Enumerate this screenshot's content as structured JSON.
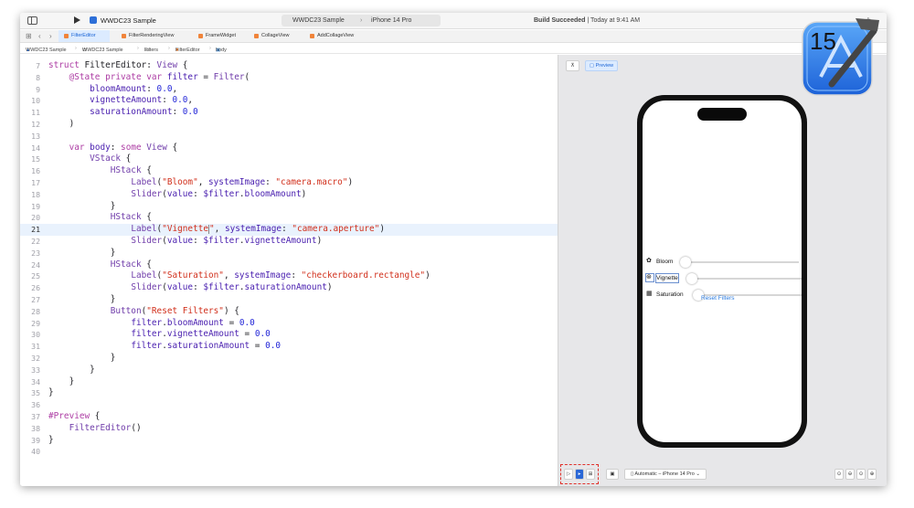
{
  "titlebar": {
    "project": "WWDC23 Sample",
    "scheme_target": "WWDC23 Sample",
    "scheme_device": "iPhone 14 Pro",
    "build_status_bold": "Build Succeeded",
    "build_status_rest": " | Today at 9:41 AM"
  },
  "tabs": [
    {
      "label": "FilterEditor",
      "active": true
    },
    {
      "label": "FilterRenderingView"
    },
    {
      "label": "FrameWidget"
    },
    {
      "label": "CollageView"
    },
    {
      "label": "AddCollageView"
    }
  ],
  "breadcrumb": [
    "WWDC23 Sample",
    "WWDC23 Sample",
    "Filters",
    "FilterEditor",
    "body"
  ],
  "editor": {
    "current_line": 21,
    "lines": [
      {
        "n": "7",
        "tokens": [
          [
            "kw",
            "struct"
          ],
          [
            "pl",
            " FilterEditor: "
          ],
          [
            "ty",
            "View"
          ],
          [
            "pl",
            " {"
          ]
        ]
      },
      {
        "n": "8",
        "tokens": [
          [
            "pl",
            "    "
          ],
          [
            "kw",
            "@State private var"
          ],
          [
            "pl",
            " "
          ],
          [
            "pr",
            "filter"
          ],
          [
            "pl",
            " = "
          ],
          [
            "ty",
            "Filter"
          ],
          [
            "pl",
            "("
          ]
        ]
      },
      {
        "n": "9",
        "tokens": [
          [
            "pl",
            "        "
          ],
          [
            "pr",
            "bloomAmount"
          ],
          [
            "pl",
            ": "
          ],
          [
            "num",
            "0.0"
          ],
          [
            "pl",
            ","
          ]
        ]
      },
      {
        "n": "10",
        "tokens": [
          [
            "pl",
            "        "
          ],
          [
            "pr",
            "vignetteAmount"
          ],
          [
            "pl",
            ": "
          ],
          [
            "num",
            "0.0"
          ],
          [
            "pl",
            ","
          ]
        ]
      },
      {
        "n": "11",
        "tokens": [
          [
            "pl",
            "        "
          ],
          [
            "pr",
            "saturationAmount"
          ],
          [
            "pl",
            ": "
          ],
          [
            "num",
            "0.0"
          ]
        ]
      },
      {
        "n": "12",
        "tokens": [
          [
            "pl",
            "    )"
          ]
        ]
      },
      {
        "n": "13",
        "tokens": []
      },
      {
        "n": "14",
        "tokens": [
          [
            "pl",
            "    "
          ],
          [
            "kw",
            "var"
          ],
          [
            "pl",
            " "
          ],
          [
            "pr",
            "body"
          ],
          [
            "pl",
            ": "
          ],
          [
            "kw",
            "some"
          ],
          [
            "pl",
            " "
          ],
          [
            "ty",
            "View"
          ],
          [
            "pl",
            " {"
          ]
        ]
      },
      {
        "n": "15",
        "tokens": [
          [
            "pl",
            "        "
          ],
          [
            "ty",
            "VStack"
          ],
          [
            "pl",
            " {"
          ]
        ]
      },
      {
        "n": "16",
        "tokens": [
          [
            "pl",
            "            "
          ],
          [
            "ty",
            "HStack"
          ],
          [
            "pl",
            " {"
          ]
        ]
      },
      {
        "n": "17",
        "tokens": [
          [
            "pl",
            "                "
          ],
          [
            "ty",
            "Label"
          ],
          [
            "pl",
            "("
          ],
          [
            "str",
            "\"Bloom\""
          ],
          [
            "pl",
            ", "
          ],
          [
            "pr",
            "systemImage"
          ],
          [
            "pl",
            ": "
          ],
          [
            "str",
            "\"camera.macro\""
          ],
          [
            "pl",
            ")"
          ]
        ]
      },
      {
        "n": "18",
        "tokens": [
          [
            "pl",
            "                "
          ],
          [
            "ty",
            "Slider"
          ],
          [
            "pl",
            "("
          ],
          [
            "pr",
            "value"
          ],
          [
            "pl",
            ": "
          ],
          [
            "pr",
            "$filter"
          ],
          [
            "pl",
            "."
          ],
          [
            "pr",
            "bloomAmount"
          ],
          [
            "pl",
            ")"
          ]
        ]
      },
      {
        "n": "19",
        "tokens": [
          [
            "pl",
            "            }"
          ]
        ]
      },
      {
        "n": "20",
        "tokens": [
          [
            "pl",
            "            "
          ],
          [
            "ty",
            "HStack"
          ],
          [
            "pl",
            " {"
          ]
        ]
      },
      {
        "n": "21",
        "tokens": [
          [
            "pl",
            "                "
          ],
          [
            "ty",
            "Label"
          ],
          [
            "pl",
            "("
          ],
          [
            "str",
            "\"Vignette"
          ],
          [
            "cursor",
            ""
          ],
          [
            "str",
            "\""
          ],
          [
            "pl",
            ", "
          ],
          [
            "pr",
            "systemImage"
          ],
          [
            "pl",
            ": "
          ],
          [
            "str",
            "\"camera.aperture\""
          ],
          [
            "pl",
            ")"
          ]
        ]
      },
      {
        "n": "22",
        "tokens": [
          [
            "pl",
            "                "
          ],
          [
            "ty",
            "Slider"
          ],
          [
            "pl",
            "("
          ],
          [
            "pr",
            "value"
          ],
          [
            "pl",
            ": "
          ],
          [
            "pr",
            "$filter"
          ],
          [
            "pl",
            "."
          ],
          [
            "pr",
            "vignetteAmount"
          ],
          [
            "pl",
            ")"
          ]
        ]
      },
      {
        "n": "23",
        "tokens": [
          [
            "pl",
            "            }"
          ]
        ]
      },
      {
        "n": "24",
        "tokens": [
          [
            "pl",
            "            "
          ],
          [
            "ty",
            "HStack"
          ],
          [
            "pl",
            " {"
          ]
        ]
      },
      {
        "n": "25",
        "tokens": [
          [
            "pl",
            "                "
          ],
          [
            "ty",
            "Label"
          ],
          [
            "pl",
            "("
          ],
          [
            "str",
            "\"Saturation\""
          ],
          [
            "pl",
            ", "
          ],
          [
            "pr",
            "systemImage"
          ],
          [
            "pl",
            ": "
          ],
          [
            "str",
            "\"checkerboard.rectangle\""
          ],
          [
            "pl",
            ")"
          ]
        ]
      },
      {
        "n": "26",
        "tokens": [
          [
            "pl",
            "                "
          ],
          [
            "ty",
            "Slider"
          ],
          [
            "pl",
            "("
          ],
          [
            "pr",
            "value"
          ],
          [
            "pl",
            ": "
          ],
          [
            "pr",
            "$filter"
          ],
          [
            "pl",
            "."
          ],
          [
            "pr",
            "saturationAmount"
          ],
          [
            "pl",
            ")"
          ]
        ]
      },
      {
        "n": "27",
        "tokens": [
          [
            "pl",
            "            }"
          ]
        ]
      },
      {
        "n": "28",
        "tokens": [
          [
            "pl",
            "            "
          ],
          [
            "ty",
            "Button"
          ],
          [
            "pl",
            "("
          ],
          [
            "str",
            "\"Reset Filters\""
          ],
          [
            "pl",
            ") {"
          ]
        ]
      },
      {
        "n": "29",
        "tokens": [
          [
            "pl",
            "                "
          ],
          [
            "pr",
            "filter"
          ],
          [
            "pl",
            "."
          ],
          [
            "pr",
            "bloomAmount"
          ],
          [
            "pl",
            " = "
          ],
          [
            "num",
            "0.0"
          ]
        ]
      },
      {
        "n": "30",
        "tokens": [
          [
            "pl",
            "                "
          ],
          [
            "pr",
            "filter"
          ],
          [
            "pl",
            "."
          ],
          [
            "pr",
            "vignetteAmount"
          ],
          [
            "pl",
            " = "
          ],
          [
            "num",
            "0.0"
          ]
        ]
      },
      {
        "n": "31",
        "tokens": [
          [
            "pl",
            "                "
          ],
          [
            "pr",
            "filter"
          ],
          [
            "pl",
            "."
          ],
          [
            "pr",
            "saturationAmount"
          ],
          [
            "pl",
            " = "
          ],
          [
            "num",
            "0.0"
          ]
        ]
      },
      {
        "n": "32",
        "tokens": [
          [
            "pl",
            "            }"
          ]
        ]
      },
      {
        "n": "33",
        "tokens": [
          [
            "pl",
            "        }"
          ]
        ]
      },
      {
        "n": "34",
        "tokens": [
          [
            "pl",
            "    }"
          ]
        ]
      },
      {
        "n": "35",
        "tokens": [
          [
            "pl",
            "}"
          ]
        ]
      },
      {
        "n": "36",
        "tokens": []
      },
      {
        "n": "37",
        "tokens": [
          [
            "kw",
            "#Preview"
          ],
          [
            "pl",
            " {"
          ]
        ]
      },
      {
        "n": "38",
        "tokens": [
          [
            "pl",
            "    "
          ],
          [
            "ty",
            "FilterEditor"
          ],
          [
            "pl",
            "()"
          ]
        ]
      },
      {
        "n": "39",
        "tokens": [
          [
            "pl",
            "}"
          ]
        ]
      },
      {
        "n": "40",
        "tokens": []
      }
    ]
  },
  "preview": {
    "preview_label": "Preview",
    "rows": [
      {
        "icon": "camera-macro-icon",
        "glyph": "✿",
        "label": "Bloom",
        "value": 0
      },
      {
        "icon": "camera-aperture-icon",
        "glyph": "⊛",
        "label": "Vignette",
        "value": 0,
        "selected": true
      },
      {
        "icon": "checkerboard-rectangle-icon",
        "glyph": "▦",
        "label": "Saturation",
        "value": 0
      }
    ],
    "reset_label": "Reset Filters",
    "device_select": "Automatic – iPhone 14 Pro"
  },
  "badge": {
    "version": "15"
  },
  "colors": {
    "accent": "#1a64d6",
    "keyword": "#ad3da4",
    "type": "#703daa",
    "string": "#d12f1b",
    "number": "#272ad8",
    "property": "#4b21b0",
    "highlight_box": "#e0312b"
  }
}
